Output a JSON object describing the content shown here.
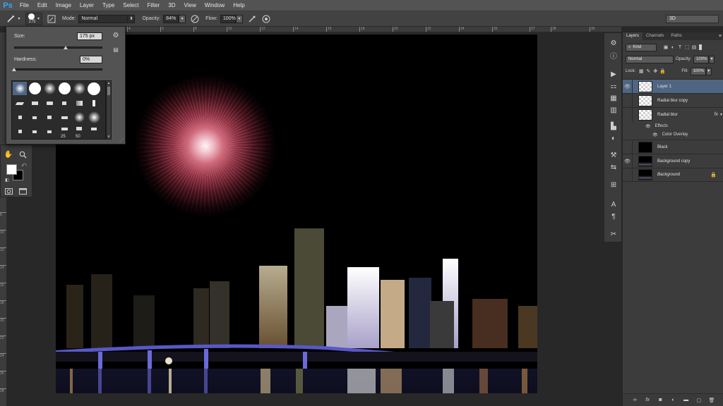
{
  "app": {
    "logo": "Ps"
  },
  "menu": [
    "File",
    "Edit",
    "Image",
    "Layer",
    "Type",
    "Select",
    "Filter",
    "3D",
    "View",
    "Window",
    "Help"
  ],
  "options": {
    "brush_size": "175",
    "mode_label": "Mode:",
    "mode_value": "Normal",
    "opacity_label": "Opacity:",
    "opacity_value": "84%",
    "flow_label": "Flow:",
    "flow_value": "100%",
    "workspace": "3D"
  },
  "brush_popup": {
    "size_label": "Size:",
    "size_value": "175 px",
    "size_level": 0.58,
    "hardness_label": "Hardness:",
    "hardness_value": "0%",
    "hardness_level": 0.0,
    "preset_numbers": [
      "25",
      "50"
    ]
  },
  "ruler": {
    "top": [
      "4",
      "6",
      "8",
      "10",
      "12",
      "14",
      "16",
      "18",
      "20",
      "22",
      "24",
      "26",
      "27",
      "28",
      "30"
    ],
    "left": [
      "8",
      "10",
      "12",
      "14",
      "16",
      "18",
      "20",
      "22",
      "24",
      "26",
      "28"
    ]
  },
  "layers_panel": {
    "tabs": [
      "Layers",
      "Channels",
      "Paths"
    ],
    "kind_label": "Kind",
    "blend_mode": "Normal",
    "opacity_label": "Opacity:",
    "opacity_value": "100%",
    "lock_label": "Lock:",
    "fill_label": "Fill:",
    "fill_value": "100%",
    "layers": [
      {
        "name": "Layer 1",
        "visible": true,
        "selected": true
      },
      {
        "name": "Radial blur copy",
        "visible": false
      },
      {
        "name": "Radial blur",
        "visible": false,
        "fx": "fx"
      },
      {
        "name": "Black",
        "visible": false
      },
      {
        "name": "Background copy",
        "visible": true
      },
      {
        "name": "Background",
        "visible": false,
        "locked": true
      }
    ],
    "effects_label": "Effects",
    "effect_item": "Color Overlay"
  },
  "colors": {
    "selected_layer": "#4e6682",
    "panel_bg": "#3c3c3c",
    "menubar_bg": "#535353",
    "ps_blue": "#31a8ff"
  }
}
